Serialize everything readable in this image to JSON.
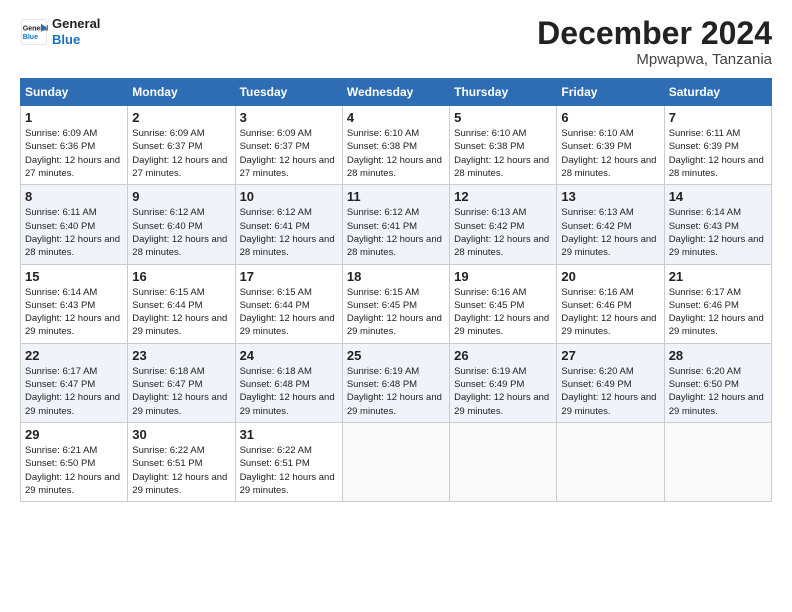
{
  "logo": {
    "line1": "General",
    "line2": "Blue"
  },
  "title": "December 2024",
  "location": "Mpwapwa, Tanzania",
  "days_of_week": [
    "Sunday",
    "Monday",
    "Tuesday",
    "Wednesday",
    "Thursday",
    "Friday",
    "Saturday"
  ],
  "weeks": [
    [
      {
        "day": 1,
        "sunrise": "6:09 AM",
        "sunset": "6:36 PM",
        "daylight": "12 hours and 27 minutes."
      },
      {
        "day": 2,
        "sunrise": "6:09 AM",
        "sunset": "6:37 PM",
        "daylight": "12 hours and 27 minutes."
      },
      {
        "day": 3,
        "sunrise": "6:09 AM",
        "sunset": "6:37 PM",
        "daylight": "12 hours and 27 minutes."
      },
      {
        "day": 4,
        "sunrise": "6:10 AM",
        "sunset": "6:38 PM",
        "daylight": "12 hours and 28 minutes."
      },
      {
        "day": 5,
        "sunrise": "6:10 AM",
        "sunset": "6:38 PM",
        "daylight": "12 hours and 28 minutes."
      },
      {
        "day": 6,
        "sunrise": "6:10 AM",
        "sunset": "6:39 PM",
        "daylight": "12 hours and 28 minutes."
      },
      {
        "day": 7,
        "sunrise": "6:11 AM",
        "sunset": "6:39 PM",
        "daylight": "12 hours and 28 minutes."
      }
    ],
    [
      {
        "day": 8,
        "sunrise": "6:11 AM",
        "sunset": "6:40 PM",
        "daylight": "12 hours and 28 minutes."
      },
      {
        "day": 9,
        "sunrise": "6:12 AM",
        "sunset": "6:40 PM",
        "daylight": "12 hours and 28 minutes."
      },
      {
        "day": 10,
        "sunrise": "6:12 AM",
        "sunset": "6:41 PM",
        "daylight": "12 hours and 28 minutes."
      },
      {
        "day": 11,
        "sunrise": "6:12 AM",
        "sunset": "6:41 PM",
        "daylight": "12 hours and 28 minutes."
      },
      {
        "day": 12,
        "sunrise": "6:13 AM",
        "sunset": "6:42 PM",
        "daylight": "12 hours and 28 minutes."
      },
      {
        "day": 13,
        "sunrise": "6:13 AM",
        "sunset": "6:42 PM",
        "daylight": "12 hours and 29 minutes."
      },
      {
        "day": 14,
        "sunrise": "6:14 AM",
        "sunset": "6:43 PM",
        "daylight": "12 hours and 29 minutes."
      }
    ],
    [
      {
        "day": 15,
        "sunrise": "6:14 AM",
        "sunset": "6:43 PM",
        "daylight": "12 hours and 29 minutes."
      },
      {
        "day": 16,
        "sunrise": "6:15 AM",
        "sunset": "6:44 PM",
        "daylight": "12 hours and 29 minutes."
      },
      {
        "day": 17,
        "sunrise": "6:15 AM",
        "sunset": "6:44 PM",
        "daylight": "12 hours and 29 minutes."
      },
      {
        "day": 18,
        "sunrise": "6:15 AM",
        "sunset": "6:45 PM",
        "daylight": "12 hours and 29 minutes."
      },
      {
        "day": 19,
        "sunrise": "6:16 AM",
        "sunset": "6:45 PM",
        "daylight": "12 hours and 29 minutes."
      },
      {
        "day": 20,
        "sunrise": "6:16 AM",
        "sunset": "6:46 PM",
        "daylight": "12 hours and 29 minutes."
      },
      {
        "day": 21,
        "sunrise": "6:17 AM",
        "sunset": "6:46 PM",
        "daylight": "12 hours and 29 minutes."
      }
    ],
    [
      {
        "day": 22,
        "sunrise": "6:17 AM",
        "sunset": "6:47 PM",
        "daylight": "12 hours and 29 minutes."
      },
      {
        "day": 23,
        "sunrise": "6:18 AM",
        "sunset": "6:47 PM",
        "daylight": "12 hours and 29 minutes."
      },
      {
        "day": 24,
        "sunrise": "6:18 AM",
        "sunset": "6:48 PM",
        "daylight": "12 hours and 29 minutes."
      },
      {
        "day": 25,
        "sunrise": "6:19 AM",
        "sunset": "6:48 PM",
        "daylight": "12 hours and 29 minutes."
      },
      {
        "day": 26,
        "sunrise": "6:19 AM",
        "sunset": "6:49 PM",
        "daylight": "12 hours and 29 minutes."
      },
      {
        "day": 27,
        "sunrise": "6:20 AM",
        "sunset": "6:49 PM",
        "daylight": "12 hours and 29 minutes."
      },
      {
        "day": 28,
        "sunrise": "6:20 AM",
        "sunset": "6:50 PM",
        "daylight": "12 hours and 29 minutes."
      }
    ],
    [
      {
        "day": 29,
        "sunrise": "6:21 AM",
        "sunset": "6:50 PM",
        "daylight": "12 hours and 29 minutes."
      },
      {
        "day": 30,
        "sunrise": "6:22 AM",
        "sunset": "6:51 PM",
        "daylight": "12 hours and 29 minutes."
      },
      {
        "day": 31,
        "sunrise": "6:22 AM",
        "sunset": "6:51 PM",
        "daylight": "12 hours and 29 minutes."
      },
      null,
      null,
      null,
      null
    ]
  ]
}
